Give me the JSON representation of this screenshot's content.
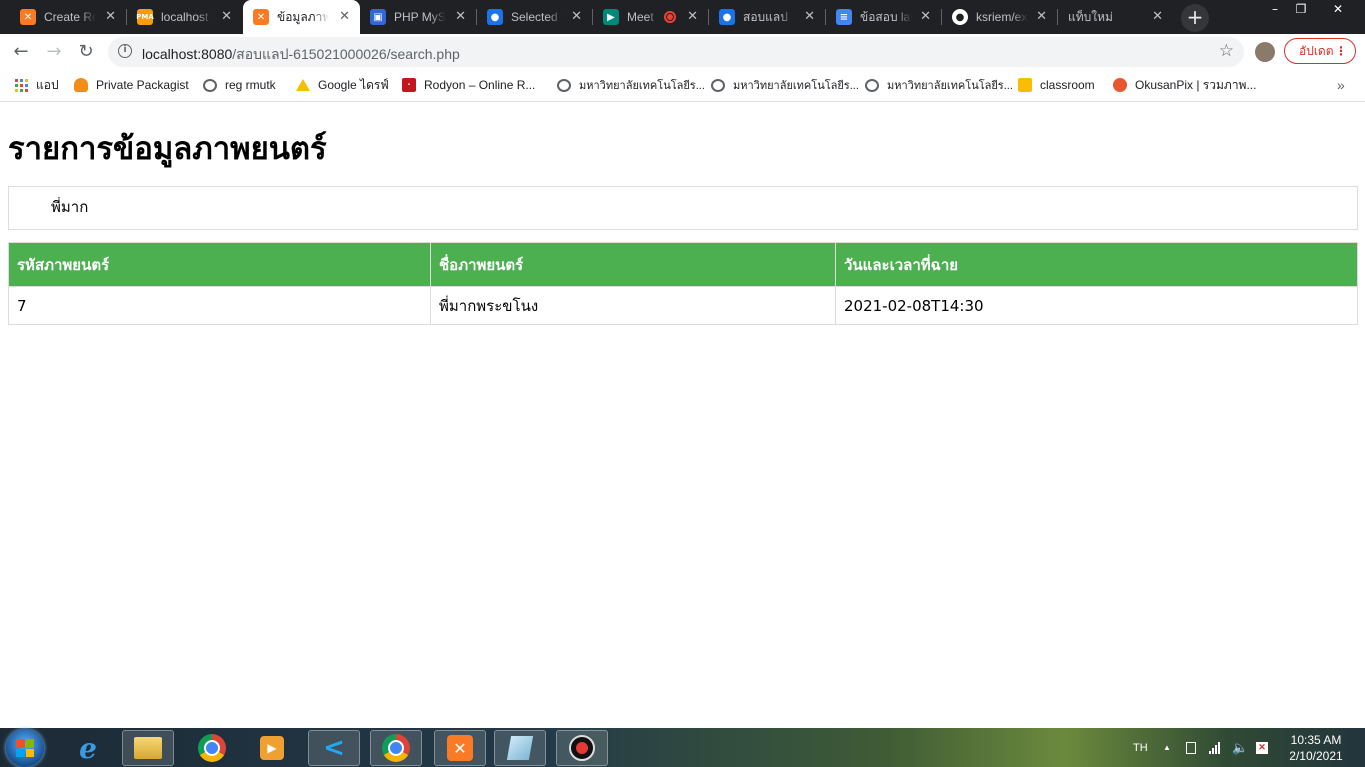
{
  "browser": {
    "tabs": [
      {
        "title": "Create Re",
        "icon": "xampp-icon",
        "icon_color": "#fb7a24"
      },
      {
        "title": "localhost",
        "icon": "phpmyadmin-icon",
        "icon_color": "#f89c0e"
      },
      {
        "title": "ข้อมูลภาพยนตร์",
        "icon": "xampp-icon",
        "icon_color": "#fb7a24",
        "active": true
      },
      {
        "title": "PHP MySQL",
        "icon": "w3schools-icon",
        "icon_color": "#3367d6"
      },
      {
        "title": "Selected T",
        "icon": "classroom-person-icon",
        "icon_color": "#1a73e8"
      },
      {
        "title": "Meet",
        "icon": "meet-icon",
        "icon_color": "#00897b"
      },
      {
        "title": "สอบแลป",
        "icon": "classroom-person-icon",
        "icon_color": "#1a73e8"
      },
      {
        "title": "ข้อสอบ lab",
        "icon": "docs-icon",
        "icon_color": "#4285f4"
      },
      {
        "title": "ksriem/ex",
        "icon": "github-icon",
        "icon_color": "#ffffff"
      },
      {
        "title": "แท็บใหม่",
        "icon": "",
        "icon_color": ""
      }
    ],
    "new_tab_label": "+",
    "window_controls": {
      "minimize": "–",
      "maximize": "❐",
      "close": "✕"
    },
    "nav": {
      "back": "←",
      "forward": "→",
      "reload": "↻"
    },
    "address": {
      "host": "localhost:8080",
      "path": "/สอบแลป-615021000026/search.php"
    },
    "bookmark_star": "☆",
    "update_button": "อัปเดต",
    "bookmarks": [
      {
        "label": "แอป",
        "icon": "apps-grid-icon"
      },
      {
        "label": "Private Packagist",
        "icon": "packagist-icon"
      },
      {
        "label": "reg rmutk",
        "icon": "globe-icon"
      },
      {
        "label": "Google ไดรฟ์",
        "icon": "google-drive-icon"
      },
      {
        "label": "Rodyon – Online R...",
        "icon": "rodyon-icon"
      },
      {
        "label": "มหาวิทยาลัยเทคโนโลยีร...",
        "icon": "globe-icon"
      },
      {
        "label": "มหาวิทยาลัยเทคโนโลยีร...",
        "icon": "globe-icon"
      },
      {
        "label": "มหาวิทยาลัยเทคโนโลยีร...",
        "icon": "globe-icon"
      },
      {
        "label": "classroom",
        "icon": "classroom-icon"
      },
      {
        "label": "OkusanPix | รวมภาพ...",
        "icon": "okusanpix-icon"
      }
    ],
    "bookmarks_overflow": "»"
  },
  "page": {
    "title": "รายการข้อมูลภาพยนตร์",
    "search_value": "พี่มาก",
    "table": {
      "headers": [
        "รหัสภาพยนตร์",
        "ชื่อภาพยนตร์",
        "วันและเวลาที่ฉาย"
      ],
      "rows": [
        [
          "7",
          "พี่มากพระขโนง",
          "2021-02-08T14:30"
        ]
      ]
    },
    "header_color": "#4caf50"
  },
  "taskbar": {
    "language": "TH",
    "time": "10:35 AM",
    "date": "2/10/2021",
    "tray_arrow": "▲"
  }
}
